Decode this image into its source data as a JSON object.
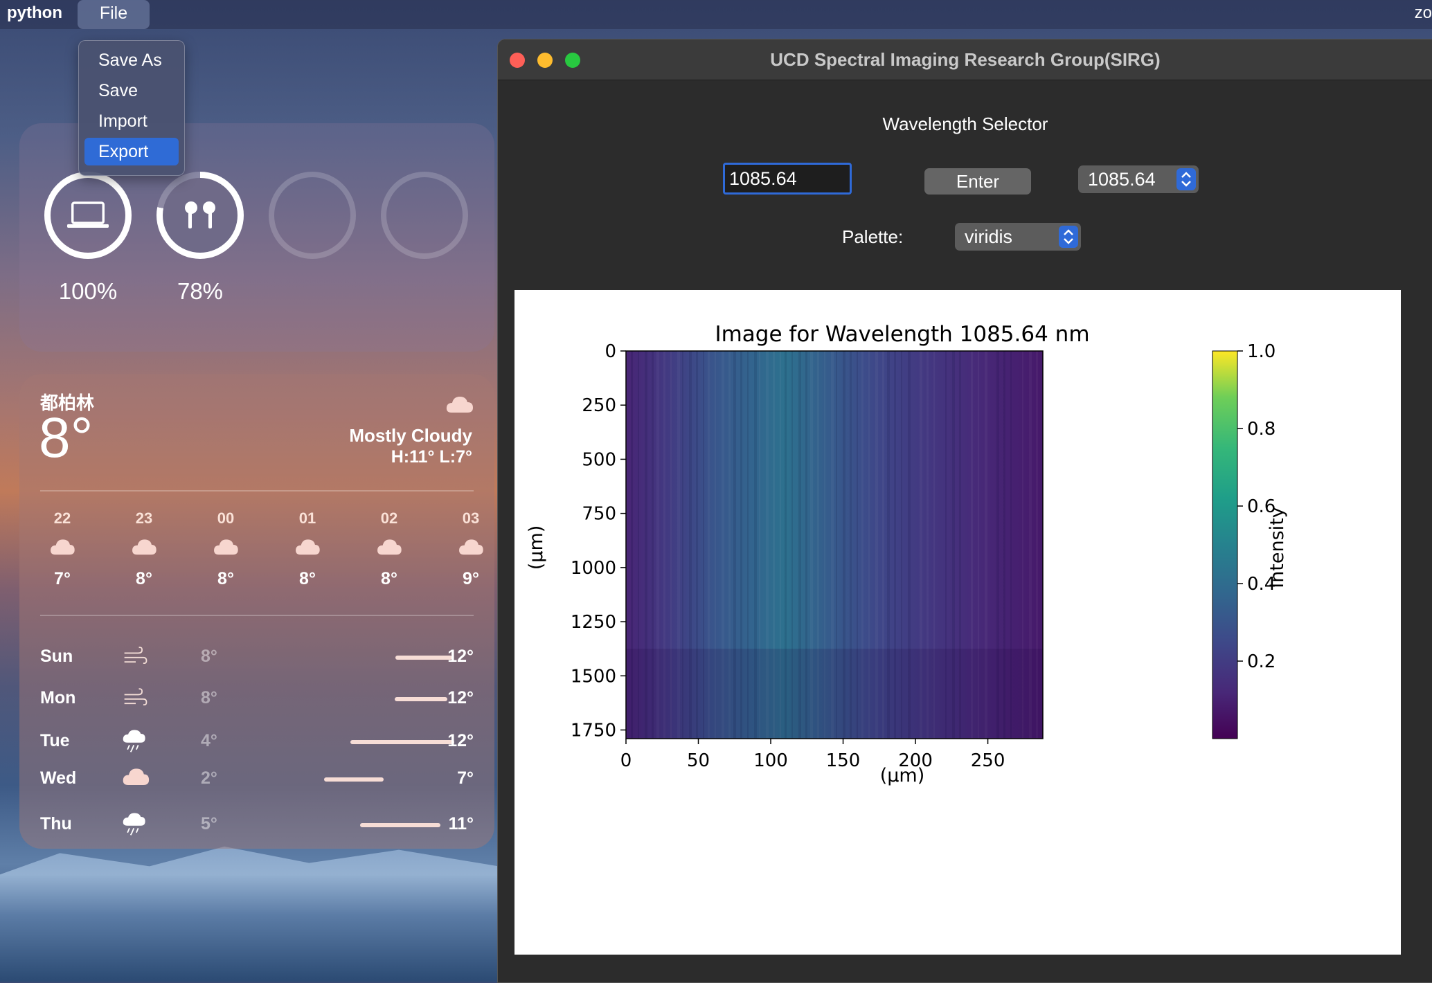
{
  "menubar": {
    "app_name": "python",
    "file_menu_label": "File",
    "right_text": "zo"
  },
  "file_menu": {
    "items": [
      "Save As",
      "Save",
      "Import",
      "Export"
    ],
    "selected": "Export"
  },
  "battery_widget": {
    "devices": [
      {
        "icon": "laptop-icon",
        "percent": "100%",
        "level": 1.0
      },
      {
        "icon": "airpods-icon",
        "percent": "78%",
        "level": 0.78
      },
      {
        "icon": "empty-slot",
        "percent": "",
        "level": 0
      },
      {
        "icon": "empty-slot",
        "percent": "",
        "level": 0
      }
    ]
  },
  "weather_widget": {
    "city": "都柏林",
    "current_temp": "8°",
    "condition": "Mostly Cloudy",
    "high_low": "H:11° L:7°",
    "hourly": [
      {
        "hour": "22",
        "icon": "cloud-icon",
        "temp": "7°"
      },
      {
        "hour": "23",
        "icon": "cloud-icon",
        "temp": "8°"
      },
      {
        "hour": "00",
        "icon": "cloud-icon",
        "temp": "8°"
      },
      {
        "hour": "01",
        "icon": "cloud-icon",
        "temp": "8°"
      },
      {
        "hour": "02",
        "icon": "cloud-icon",
        "temp": "8°"
      },
      {
        "hour": "03",
        "icon": "cloud-icon",
        "temp": "9°"
      }
    ],
    "daily": [
      {
        "day": "Sun",
        "icon": "wind-icon",
        "low": "8°",
        "high": "12°"
      },
      {
        "day": "Mon",
        "icon": "wind-icon",
        "low": "8°",
        "high": "12°"
      },
      {
        "day": "Tue",
        "icon": "rain-icon",
        "low": "4°",
        "high": "12°"
      },
      {
        "day": "Wed",
        "icon": "cloud-icon",
        "low": "2°",
        "high": "7°"
      },
      {
        "day": "Thu",
        "icon": "rain-icon",
        "low": "5°",
        "high": "11°"
      }
    ]
  },
  "window": {
    "title": "UCD Spectral Imaging Research Group(SIRG)",
    "wavelength_label": "Wavelength Selector",
    "wavelength_input": "1085.64",
    "enter_button": "Enter",
    "wavelength_select": "1085.64",
    "palette_label": "Palette:",
    "palette_select": "viridis"
  },
  "colors": {
    "accent": "#2f6ad8",
    "close": "#fe5f57",
    "minimize": "#febc2e",
    "maximize": "#28c840"
  },
  "chart_data": {
    "type": "heatmap",
    "title": "Image for Wavelength 1085.64 nm",
    "xlabel": "(µm)",
    "ylabel": "(µm)",
    "x_ticks": [
      "0",
      "50",
      "100",
      "150",
      "200",
      "250"
    ],
    "y_ticks": [
      "0",
      "250",
      "500",
      "750",
      "1000",
      "1250",
      "1500",
      "1750"
    ],
    "xlim": [
      0,
      288
    ],
    "ylim": [
      1790,
      0
    ],
    "colormap": "viridis",
    "colorbar": {
      "label": "Intensity",
      "ticks": [
        "0.2",
        "0.4",
        "0.6",
        "0.8",
        "1.0"
      ],
      "range": [
        0.0,
        1.0
      ]
    },
    "intensity_profile_by_x": [
      {
        "x": 0,
        "value": 0.12
      },
      {
        "x": 30,
        "value": 0.2
      },
      {
        "x": 60,
        "value": 0.3
      },
      {
        "x": 90,
        "value": 0.37
      },
      {
        "x": 110,
        "value": 0.42
      },
      {
        "x": 140,
        "value": 0.33
      },
      {
        "x": 170,
        "value": 0.25
      },
      {
        "x": 200,
        "value": 0.2
      },
      {
        "x": 240,
        "value": 0.14
      },
      {
        "x": 288,
        "value": 0.08
      }
    ]
  }
}
